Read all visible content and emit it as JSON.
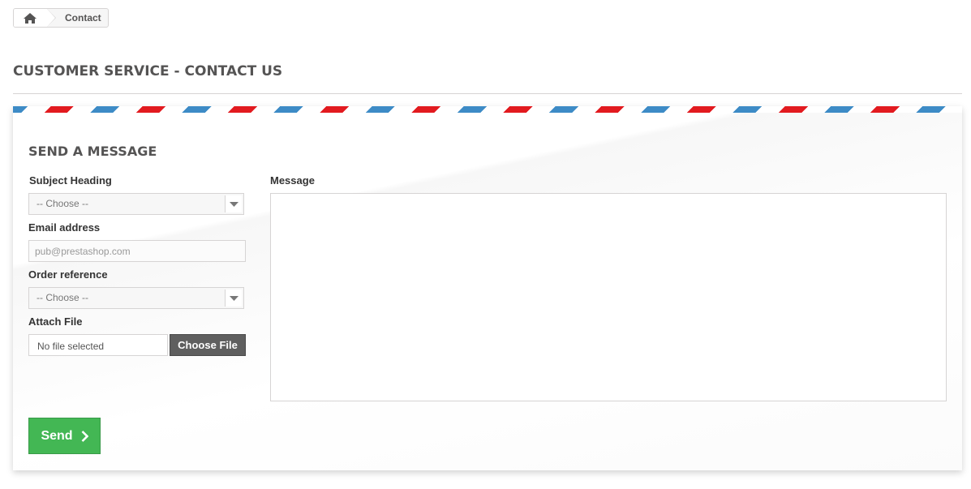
{
  "breadcrumb": {
    "home_icon": "home-icon",
    "current": "Contact"
  },
  "page_heading": "CUSTOMER SERVICE - CONTACT US",
  "form": {
    "heading": "SEND A MESSAGE",
    "subject_label": "Subject Heading",
    "subject_value": "-- Choose --",
    "email_label": "Email address",
    "email_placeholder": "pub@prestashop.com",
    "order_label": "Order reference",
    "order_value": "-- Choose --",
    "attach_label": "Attach File",
    "file_name": "No file selected",
    "choose_file": "Choose File",
    "message_label": "Message",
    "message_value": "",
    "send_label": "Send"
  },
  "colors": {
    "stripe_blue": "#3d8bc6",
    "stripe_red": "#e21a1f",
    "send_green": "#43b754"
  }
}
